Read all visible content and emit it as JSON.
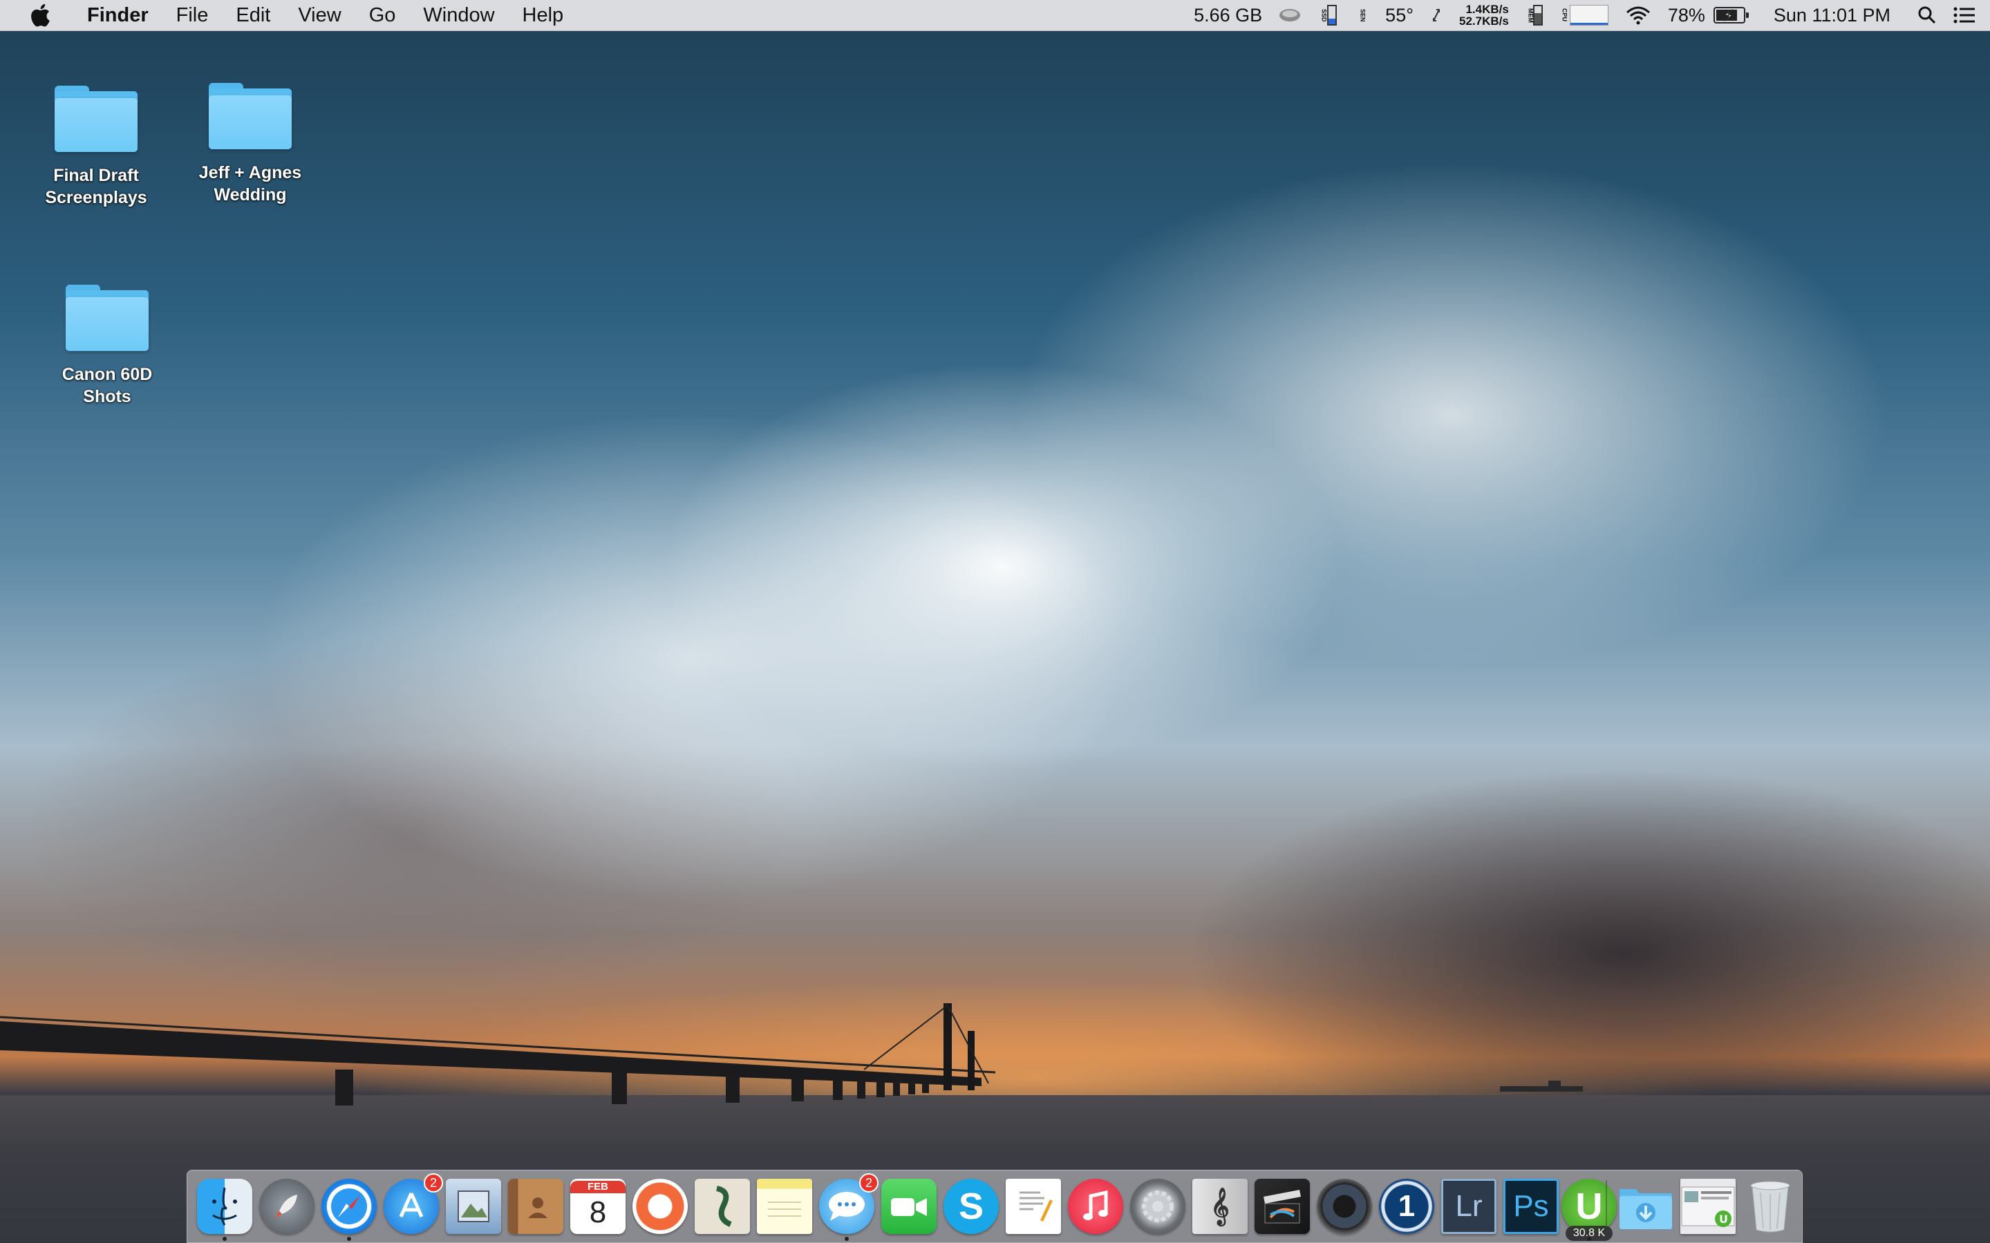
{
  "menubar": {
    "apple_icon": "apple-logo-icon",
    "app_name": "Finder",
    "items": [
      "File",
      "Edit",
      "View",
      "Go",
      "Window",
      "Help"
    ],
    "status": {
      "memory_free": "5.66 GB",
      "temperature": "55°",
      "net_up": "1.4KB/s",
      "net_down": "52.7KB/s",
      "battery_percent": "78%",
      "battery_level": 0.78,
      "clock": "Sun 11:01 PM",
      "ssd_label": "SSD",
      "mem_label": "MEM",
      "cpu_label": "CPU"
    }
  },
  "desktop": {
    "folders": [
      {
        "label_line1": "Final Draft",
        "label_line2": "Screenplays"
      },
      {
        "label_line1": "Jeff + Agnes",
        "label_line2": "Wedding"
      },
      {
        "label_line1": "Canon 60D",
        "label_line2": "Shots"
      }
    ]
  },
  "dock": {
    "items": [
      {
        "name": "Finder",
        "icon": "finder-icon",
        "running": true
      },
      {
        "name": "Launchpad",
        "icon": "rocket-icon",
        "running": false
      },
      {
        "name": "Safari",
        "icon": "compass-icon",
        "running": true
      },
      {
        "name": "App Store",
        "icon": "app-store-icon",
        "running": false,
        "badge": "2"
      },
      {
        "name": "Preview",
        "icon": "preview-icon",
        "running": false
      },
      {
        "name": "Contacts",
        "icon": "contacts-icon",
        "running": false
      },
      {
        "name": "Calendar",
        "icon": "calendar-icon",
        "running": false,
        "month": "FEB",
        "day": "8"
      },
      {
        "name": "Sunrise",
        "icon": "sunrise-icon",
        "running": false
      },
      {
        "name": "Scrivener",
        "icon": "scrivener-icon",
        "running": false
      },
      {
        "name": "Notes",
        "icon": "notes-icon",
        "running": false
      },
      {
        "name": "Messages",
        "icon": "messages-icon",
        "running": true,
        "badge": "2"
      },
      {
        "name": "FaceTime",
        "icon": "facetime-icon",
        "running": false
      },
      {
        "name": "Skype",
        "icon": "skype-icon",
        "running": false,
        "glyph": "S"
      },
      {
        "name": "Pages",
        "icon": "pages-icon",
        "running": false
      },
      {
        "name": "iTunes",
        "icon": "music-note-icon",
        "running": false
      },
      {
        "name": "System Preferences",
        "icon": "gear-icon",
        "running": false
      },
      {
        "name": "Logic",
        "icon": "music-score-icon",
        "running": false
      },
      {
        "name": "Final Cut Pro",
        "icon": "clapperboard-icon",
        "running": false
      },
      {
        "name": "Aperture",
        "icon": "camera-lens-icon",
        "running": false
      },
      {
        "name": "1Password",
        "icon": "1password-icon",
        "running": false,
        "glyph": "1"
      },
      {
        "name": "Lightroom",
        "icon": "lightroom-icon",
        "running": false,
        "glyph": "Lr"
      },
      {
        "name": "Photoshop",
        "icon": "photoshop-icon",
        "running": false,
        "glyph": "Ps"
      },
      {
        "name": "uTorrent",
        "icon": "utorrent-icon",
        "running": true,
        "glyph": "U",
        "label_badge": "30.8 K"
      }
    ],
    "right_items": [
      {
        "name": "Downloads",
        "icon": "downloads-folder-icon"
      },
      {
        "name": "Recent Download",
        "icon": "stack-preview-icon"
      },
      {
        "name": "Trash",
        "icon": "trash-icon"
      }
    ]
  }
}
